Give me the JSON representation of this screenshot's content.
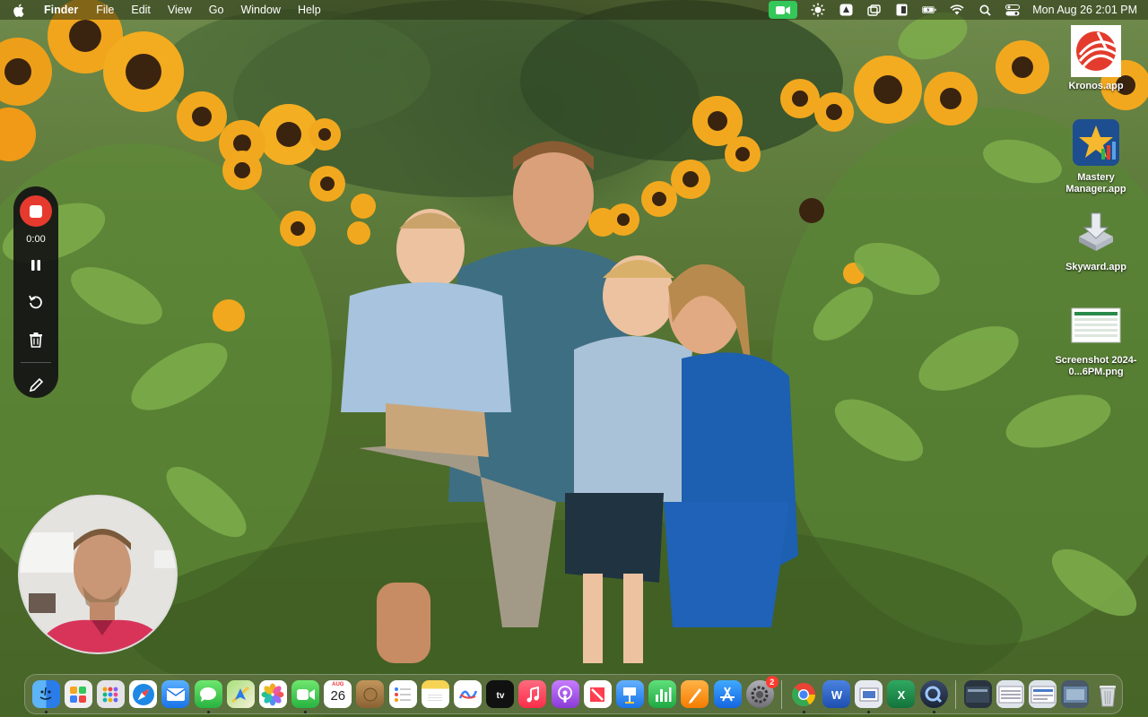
{
  "menubar": {
    "app_name": "Finder",
    "menus": [
      "File",
      "Edit",
      "View",
      "Go",
      "Window",
      "Help"
    ],
    "clock": "Mon Aug 26  2:01 PM"
  },
  "recorder": {
    "timer": "0:00"
  },
  "desktop_icons": [
    {
      "label": "Kronos.app"
    },
    {
      "label": "Mastery Manager.app"
    },
    {
      "label": "Skyward.app"
    },
    {
      "label": "Screenshot 2024-0...6PM.png"
    }
  ],
  "dock": {
    "calendar_month": "AUG",
    "calendar_day": "26",
    "settings_badge": "2",
    "items": [
      {
        "name": "finder",
        "color": "#3a8ef0"
      },
      {
        "name": "launchpad",
        "color": "#e8e8e8"
      },
      {
        "name": "apps-grid",
        "color": "#f2f2f2"
      },
      {
        "name": "safari",
        "color": "#2d8ff0"
      },
      {
        "name": "mail",
        "color": "#3b92f5"
      },
      {
        "name": "messages",
        "color": "#34c759"
      },
      {
        "name": "maps",
        "color": "#5fb85a"
      },
      {
        "name": "photos",
        "color": "#ffffff"
      },
      {
        "name": "facetime",
        "color": "#34c759"
      },
      {
        "name": "calendar",
        "color": "#ffffff"
      },
      {
        "name": "notes-bag",
        "color": "#a07a4a"
      },
      {
        "name": "reminders",
        "color": "#ffffff"
      },
      {
        "name": "notes",
        "color": "#f7d354"
      },
      {
        "name": "freeform",
        "color": "#ffffff"
      },
      {
        "name": "apple-tv",
        "color": "#111111"
      },
      {
        "name": "music",
        "color": "#fb3b52"
      },
      {
        "name": "podcasts",
        "color": "#9b4fe0"
      },
      {
        "name": "news",
        "color": "#ff3b4e"
      },
      {
        "name": "keynote",
        "color": "#2e8ff0"
      },
      {
        "name": "numbers",
        "color": "#2cbd4a"
      },
      {
        "name": "pages",
        "color": "#f79a2b"
      },
      {
        "name": "app-store",
        "color": "#1c8cf0"
      },
      {
        "name": "system-settings",
        "color": "#8e8e93"
      },
      {
        "name": "chrome",
        "color": "#ffffff"
      },
      {
        "name": "word",
        "color": "#2b5fbf"
      },
      {
        "name": "preview",
        "color": "#d0d6e0"
      },
      {
        "name": "excel",
        "color": "#1f8a4c"
      },
      {
        "name": "quicktime",
        "color": "#2a3a55"
      }
    ]
  }
}
